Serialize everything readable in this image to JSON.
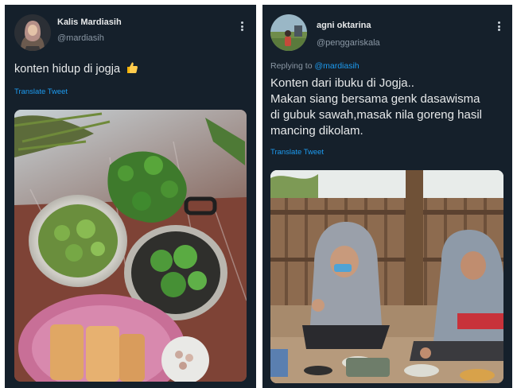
{
  "left_tweet": {
    "author_name": "Kalis Mardiasih",
    "author_handle": "@mardiasih",
    "text": "konten hidup di jogja",
    "emoji": "thumbs-up",
    "translate_label": "Translate Tweet",
    "avatar_icon": "avatar-woman-hijab",
    "media_icon": "photo-cooking-pots-vegetables"
  },
  "right_tweet": {
    "author_name": "agni oktarina",
    "author_handle": "@penggariskala",
    "replying_to_label": "Replying to",
    "replying_to_handle": "@mardiasih",
    "text_lines": [
      "Konten dari ibuku di Jogja..",
      "Makan siang bersama genk dasawisma",
      "di gubuk sawah,masak nila goreng hasil",
      "mancing dikolam."
    ],
    "translate_label": "Translate Tweet",
    "avatar_icon": "avatar-landscape-person",
    "media_icon": "photo-women-eating-hut"
  },
  "colors": {
    "background": "#15202b",
    "text": "#e7e9ea",
    "secondary_text": "#8b98a5",
    "link": "#1d9bf0"
  }
}
